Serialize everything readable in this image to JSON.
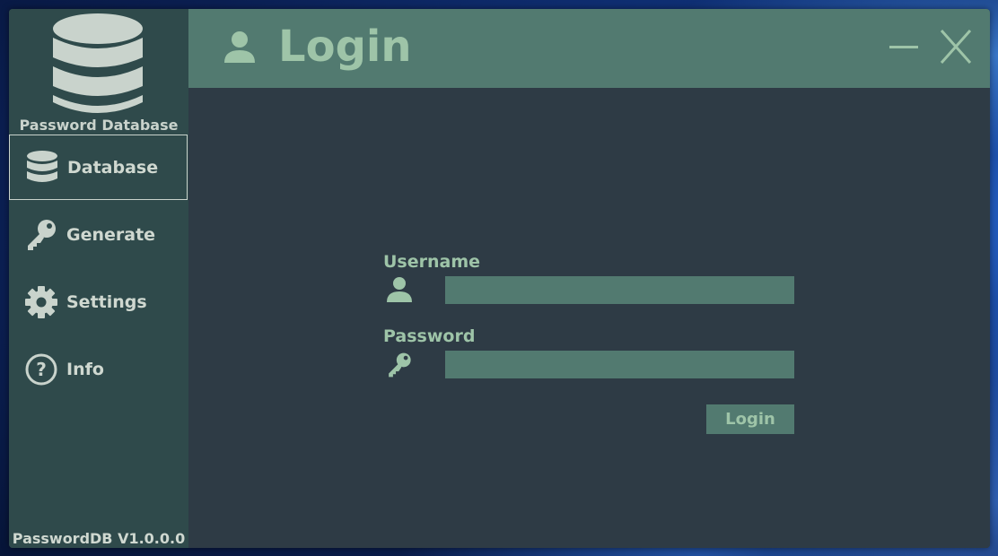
{
  "app": {
    "brand_name": "Password Database",
    "version": "PasswordDB V1.0.0.0"
  },
  "sidebar": {
    "items": [
      {
        "label": "Database",
        "icon": "database-icon",
        "active": true
      },
      {
        "label": "Generate",
        "icon": "key-icon",
        "active": false
      },
      {
        "label": "Settings",
        "icon": "gear-icon",
        "active": false
      },
      {
        "label": "Info",
        "icon": "question-icon",
        "active": false
      }
    ]
  },
  "header": {
    "title": "Login",
    "icon": "user-icon"
  },
  "form": {
    "username_label": "Username",
    "username_value": "",
    "password_label": "Password",
    "password_value": "",
    "login_label": "Login"
  },
  "colors": {
    "sidebar_bg": "#2f4a4b",
    "content_bg": "#2e3b45",
    "accent": "#527a70",
    "accent_text": "#9ec4a8",
    "light_text": "#cfd8d0"
  }
}
